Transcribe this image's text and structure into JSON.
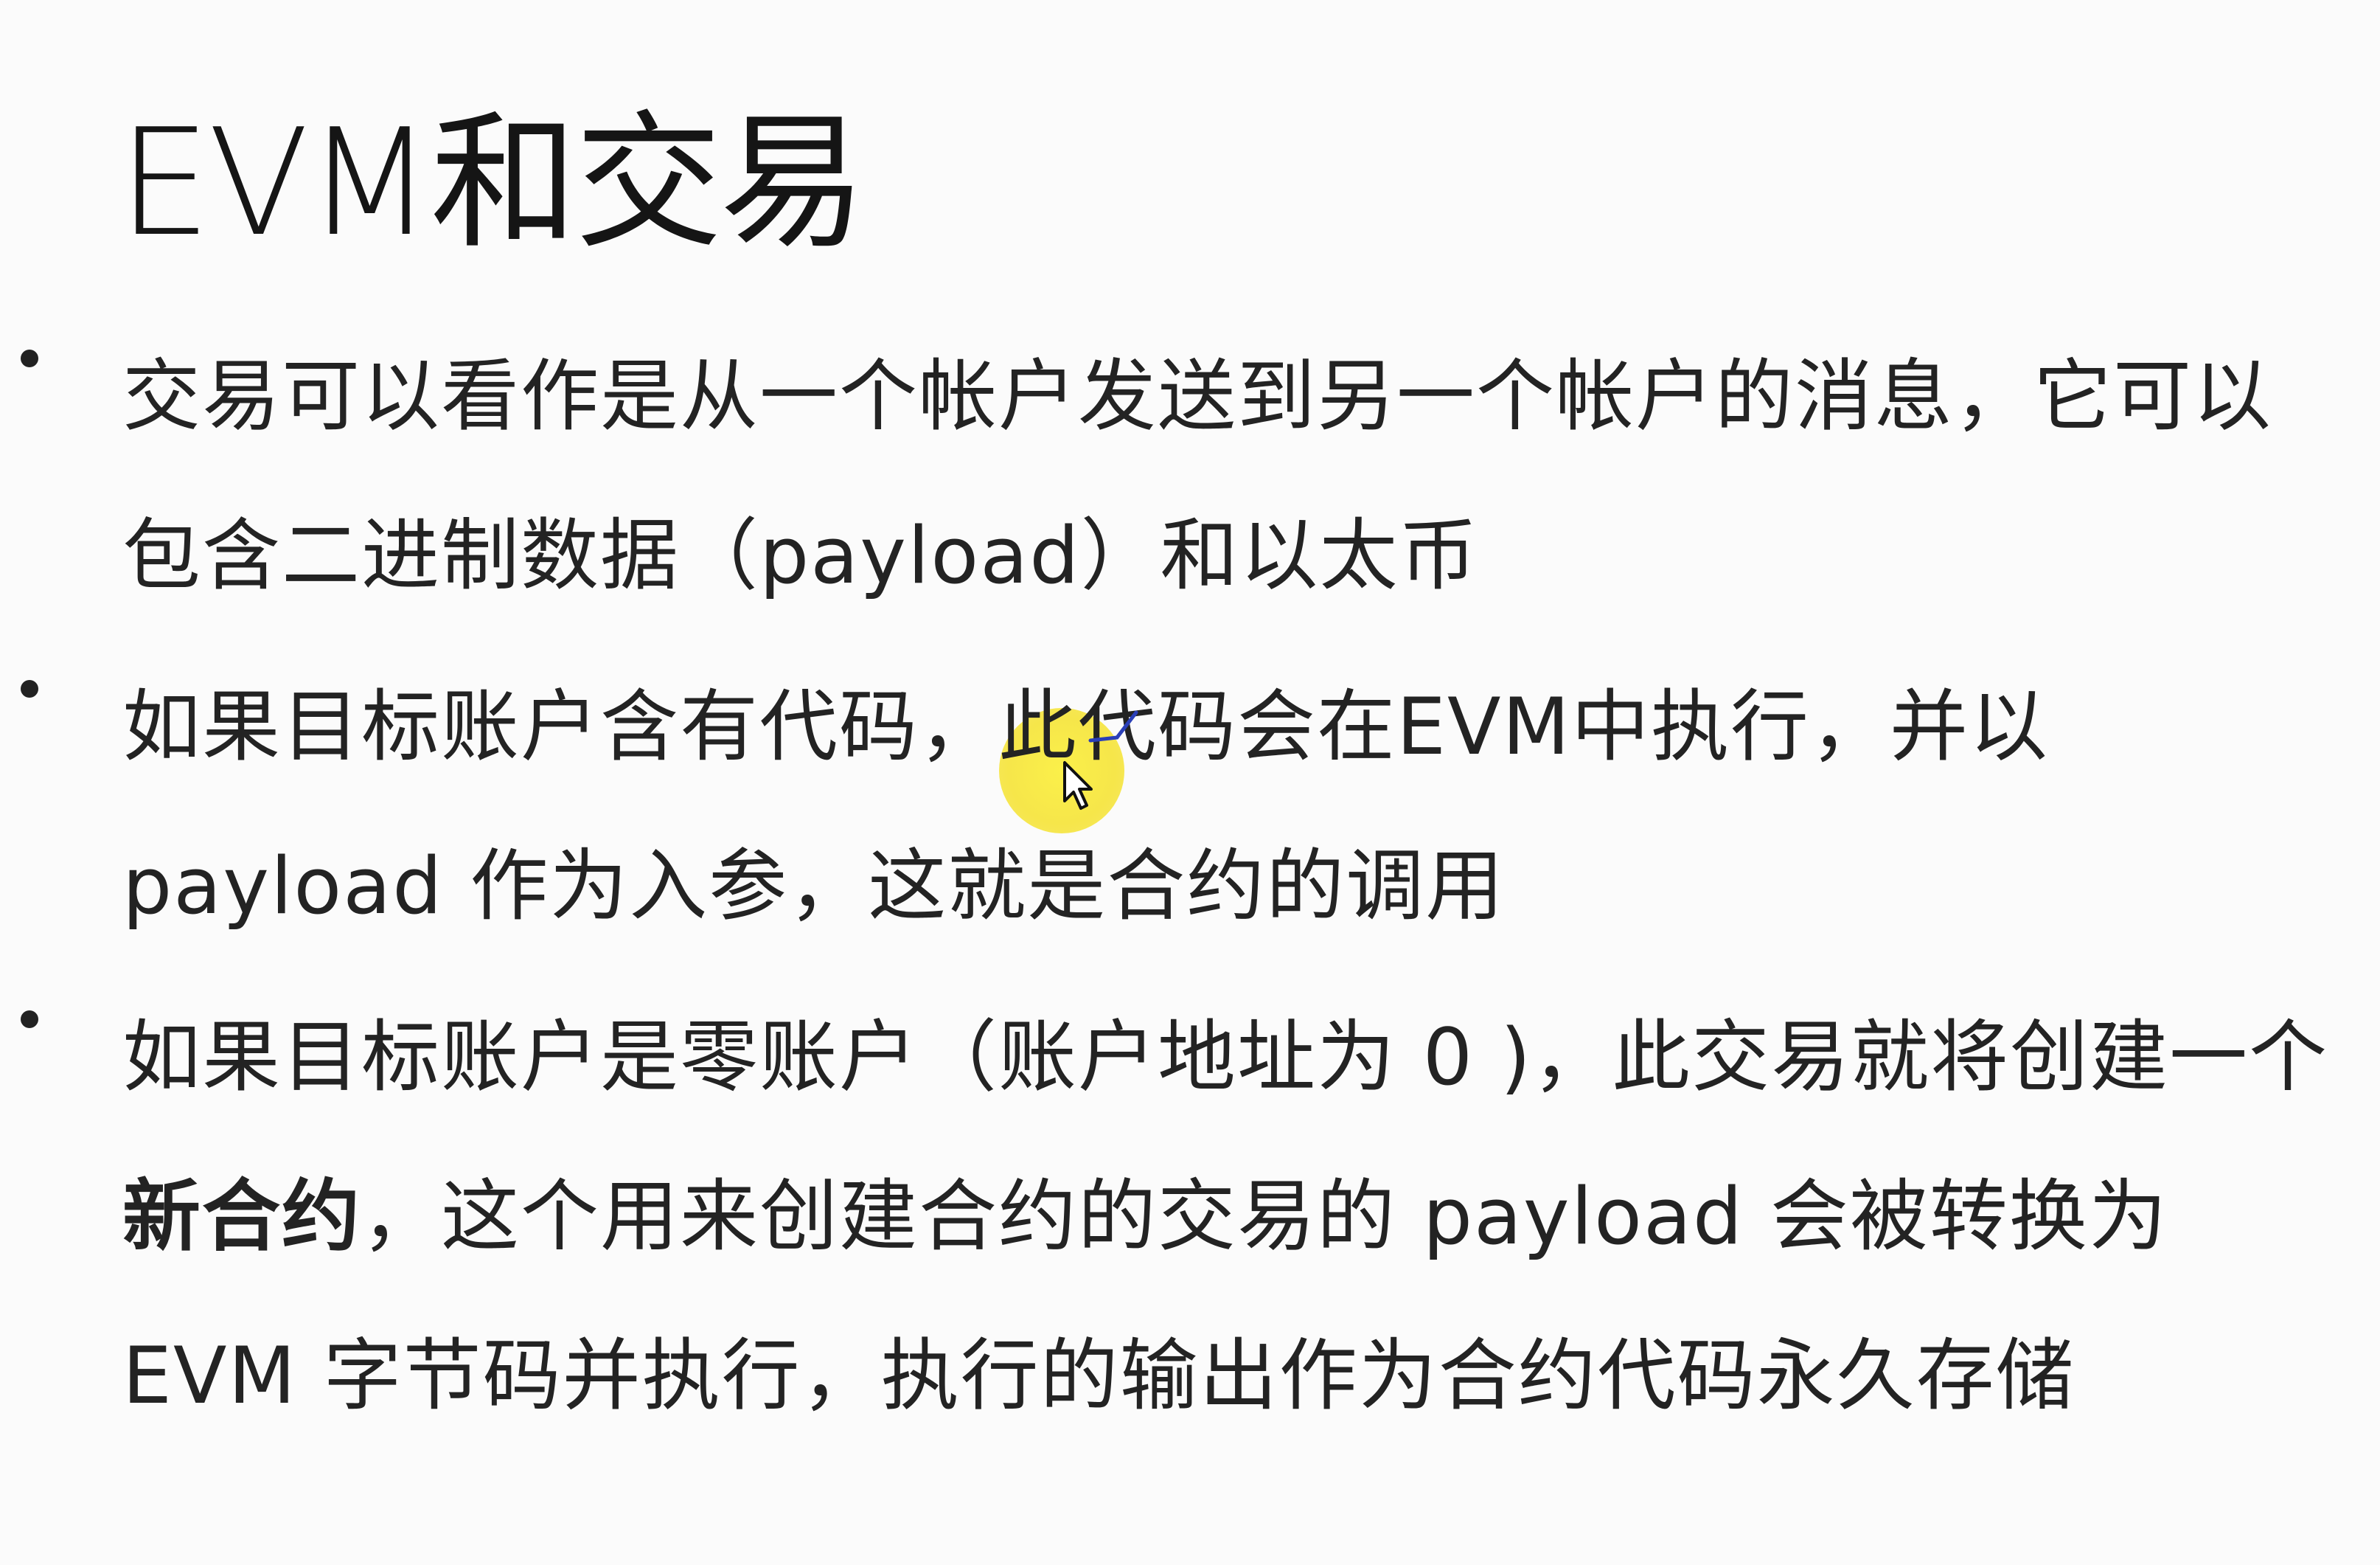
{
  "slide": {
    "title": "EVM和交易",
    "bullets": [
      {
        "parts": [
          {
            "text": "交易可以看作是从一个帐户发送到另一个帐户的消息，它可以包含二进制数据（payload）和以太币",
            "bold": false
          }
        ]
      },
      {
        "parts": [
          {
            "text": "如果目标账户含有代码，此代码会在EVM中执行，并以 payload 作为入参，这就是合约的调用",
            "bold": false
          }
        ]
      },
      {
        "parts": [
          {
            "text": "如果目标账户是零账户（账户地址为 0 )，此交易就将创建一个 ",
            "bold": false
          },
          {
            "text": "新合约",
            "bold": true
          },
          {
            "text": "，这个用来创建合约的交易的 payload 会被转换为 EVM 字节码并执行，执行的输出作为合约代码永久存储",
            "bold": false
          }
        ]
      }
    ]
  },
  "icons": {
    "bullet": "bullet-dot-icon",
    "cursor": "mouse-pointer-icon",
    "highlight": "cursor-highlight-circle"
  },
  "colors": {
    "highlight": "#f6e64a",
    "pen_mark": "#2a3fb8",
    "text": "#232323"
  }
}
